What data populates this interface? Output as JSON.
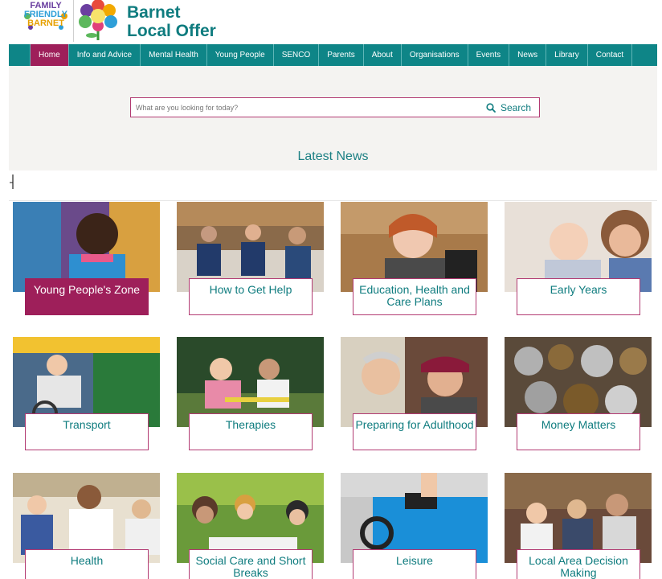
{
  "header": {
    "ffb_logo_lines": [
      "FAMILY",
      "FRIENDLY",
      "BARNET"
    ],
    "brand_line1": "Barnet",
    "brand_line2": "Local Offer"
  },
  "nav": {
    "items": [
      {
        "label": "Home",
        "active": true
      },
      {
        "label": "Info and Advice"
      },
      {
        "label": "Mental Health"
      },
      {
        "label": "Young People"
      },
      {
        "label": "SENCO"
      },
      {
        "label": "Parents"
      },
      {
        "label": "About"
      },
      {
        "label": "Organisations"
      },
      {
        "label": "Events"
      },
      {
        "label": "News"
      },
      {
        "label": "Library"
      },
      {
        "label": "Contact"
      }
    ]
  },
  "search": {
    "placeholder": "What are you looking for today?",
    "button_label": "Search"
  },
  "news": {
    "title": "Latest News"
  },
  "tiles": [
    {
      "label": "Young People's Zone",
      "active": true
    },
    {
      "label": "How to Get Help"
    },
    {
      "label": "Education, Health and Care Plans"
    },
    {
      "label": "Early Years"
    },
    {
      "label": "Transport"
    },
    {
      "label": "Therapies"
    },
    {
      "label": "Preparing for Adulthood"
    },
    {
      "label": "Money Matters"
    },
    {
      "label": "Health"
    },
    {
      "label": "Social Care and Short Breaks"
    },
    {
      "label": "Leisure"
    },
    {
      "label": "Local Area Decision Making"
    }
  ],
  "colors": {
    "teal": "#0e8587",
    "magenta": "#9e1f5a",
    "accent_border": "#b23a72"
  }
}
